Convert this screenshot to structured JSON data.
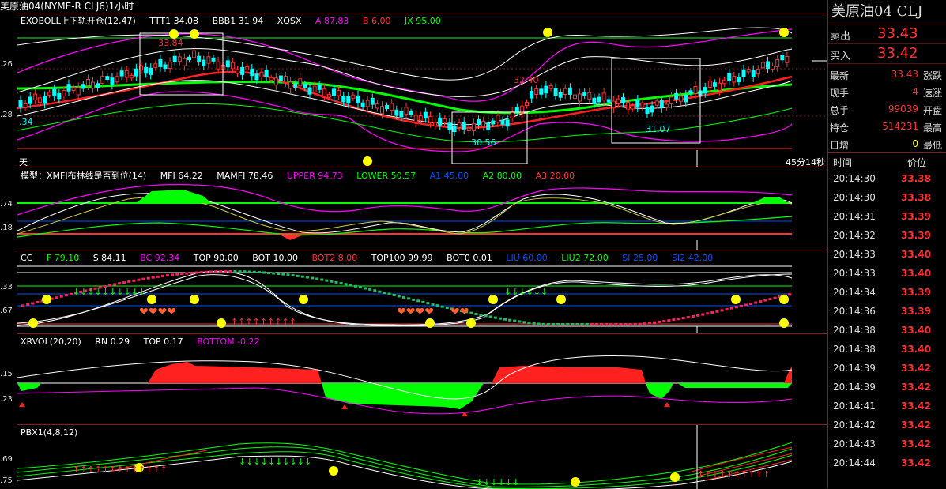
{
  "window_title": "美原油04(NYME-R CLJ6)1小时",
  "panels": {
    "p1": {
      "name": "EXOBOLL上下轨开仓(12,47)",
      "TTT1": "TTT1 34.08",
      "BBB1": "BBB1 31.94",
      "XQSX": "XQSX",
      "A": "A 87.83",
      "B": "B 6.00",
      "JX": "JX 95.00",
      "ann_high": "33.84",
      "ann_mid": "32.40",
      "ann_low1": "30.56",
      "ann_low2": "31.07",
      "ann_left": ".34",
      "y_top": ".26",
      "y_bot": ".28",
      "status_left": "天",
      "status_right": "45分14秒"
    },
    "p2": {
      "name": "模型：XMFI布林线是否到位(14)",
      "MFI": "MFI 64.22",
      "MAMFI": "MAMFI 78.46",
      "UPPER": "UPPER 94.73",
      "LOWER": "LOWER 50.57",
      "A1": "A1 45.00",
      "A2": "A2 80.00",
      "A3": "A3 20.00",
      "y_top": ".74",
      "y_bot": ".18"
    },
    "p3": {
      "name": "CC",
      "F": "F 79.10",
      "S": "S 84.11",
      "BC": "BC 92.34",
      "TOP": "TOP 90.00",
      "BOT": "BOT 10.00",
      "BOT2": "BOT2 8.00",
      "TOP100": "TOP100 99.99",
      "BOT0": "BOT0 0.01",
      "LIU": "LIU 60.00",
      "LIU2": "LIU2 72.00",
      "SI": "SI 25.00",
      "SI2": "SI2 42.00",
      "y_top": ".33",
      "y_bot": ".67"
    },
    "p4": {
      "name": "XRVOL(20,20)",
      "RN": "RN 0.29",
      "TOP": "TOP 0.17",
      "BOTTOM": "BOTTOM -0.22",
      "y_top": ".15",
      "y_bot": ".23"
    },
    "p5": {
      "name": "PBX1(4,8,12)",
      "y_top": ".69",
      "y_bot": ".75"
    }
  },
  "quote": {
    "title": "美原油04 CLJ",
    "ask_label": "卖出",
    "ask": "33.43",
    "bid_label": "买入",
    "bid": "33.42",
    "stats": [
      {
        "k": "最新",
        "v": "33.43",
        "k2": "涨跌"
      },
      {
        "k": "现手",
        "v": "4",
        "k2": "速涨"
      },
      {
        "k": "总手",
        "v": "99039",
        "k2": "开盘"
      },
      {
        "k": "持仓",
        "v": "514231",
        "k2": "最高"
      },
      {
        "k": "日增",
        "v": "0",
        "k2": "最低"
      }
    ],
    "ticks_hdr": {
      "time": "时间",
      "price": "价位"
    },
    "ticks": [
      {
        "t": "20:14:30",
        "p": "33.38"
      },
      {
        "t": "20:14:30",
        "p": "33.38"
      },
      {
        "t": "20:14:31",
        "p": "33.39"
      },
      {
        "t": "20:14:32",
        "p": "33.39"
      },
      {
        "t": "20:14:33",
        "p": "33.40"
      },
      {
        "t": "20:14:33",
        "p": "33.40"
      },
      {
        "t": "20:14:34",
        "p": "33.39"
      },
      {
        "t": "20:14:36",
        "p": "33.39"
      },
      {
        "t": "20:14:38",
        "p": "33.40"
      },
      {
        "t": "20:14:38",
        "p": "33.40"
      },
      {
        "t": "20:14:39",
        "p": "33.42"
      },
      {
        "t": "20:14:39",
        "p": "33.42"
      },
      {
        "t": "20:14:41",
        "p": "33.42"
      },
      {
        "t": "20:14:42",
        "p": "33.42"
      },
      {
        "t": "20:14:43",
        "p": "33.42"
      },
      {
        "t": "20:14:44",
        "p": "33.42"
      }
    ]
  },
  "colors": {
    "up": "#ff3030",
    "down": "#00ffff",
    "grid": "#8a1c1c",
    "green": "#00ff00",
    "magenta": "#ff00ff",
    "yellow": "#ffff00",
    "white": "#ffffff"
  },
  "icons": [
    "smiley-icon",
    "heart-icon",
    "arrow-up-icon",
    "arrow-down-icon"
  ]
}
